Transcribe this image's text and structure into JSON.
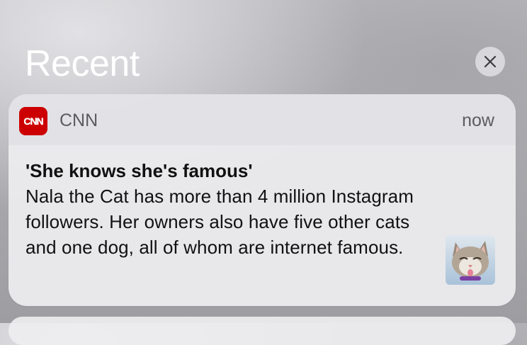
{
  "section": {
    "title": "Recent",
    "clear_icon": "close-icon"
  },
  "notification": {
    "app": {
      "name": "CNN",
      "icon_text": "CNN",
      "icon_color": "#cc0000"
    },
    "timestamp": "now",
    "title": "'She knows she's famous'",
    "body": "Nala the Cat has more than 4 million Instagram followers. Her owners also have five other cats and one dog, all of whom are internet famous.",
    "thumbnail": "cat-thumbnail"
  }
}
